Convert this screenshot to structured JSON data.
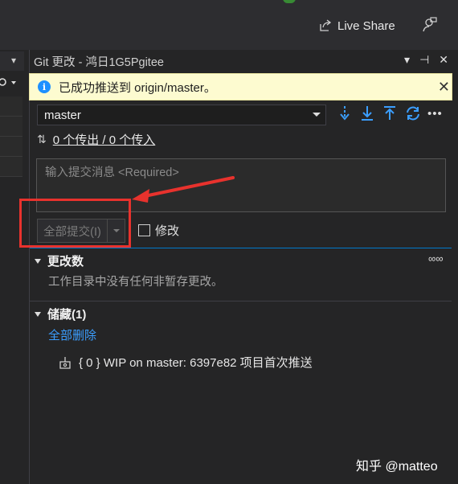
{
  "toolbar": {
    "live_share_label": "Live Share"
  },
  "panel": {
    "title": "Git 更改 - 鸿日1G5Pgitee",
    "title_buttons": [
      "▾",
      "⊣",
      "✕"
    ]
  },
  "notification": {
    "message": "已成功推送到 origin/master。",
    "info_glyph": "i",
    "close_glyph": "✕"
  },
  "branch": {
    "selected": "master"
  },
  "sync": {
    "icon": "⇅",
    "link": "0 个传出 / 0 个传入"
  },
  "commit": {
    "message_placeholder": "输入提交消息 <Required>",
    "commit_all_label": "全部提交(I)",
    "amend_label": "修改"
  },
  "changes_section": {
    "title": "更改数",
    "more_glyph": "∞∞",
    "empty_message": "工作目录中没有任何非暂存更改。"
  },
  "stash_section": {
    "title": "储藏(1)",
    "delete_all": "全部删除",
    "items": [
      {
        "label": "{ 0 } WIP on master: 6397e82 项目首次推送"
      }
    ]
  },
  "watermark": "知乎 @matteo",
  "colors": {
    "background": "#252526",
    "accent_blue": "#007acc",
    "link_blue": "#3b9eff",
    "info_bar": "#fdfbd0",
    "annotation_red": "#e8322d"
  },
  "icons": {
    "live_share": "live-share-icon",
    "feedback": "feedback-icon",
    "fetch": "fetch-icon",
    "pull": "pull-icon",
    "push": "push-icon",
    "sync": "sync-icon",
    "stash": "stash-icon"
  }
}
